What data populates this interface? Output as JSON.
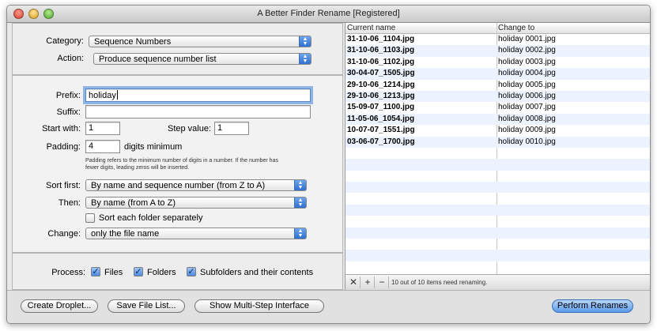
{
  "window": {
    "title": "A Better Finder Rename [Registered]"
  },
  "settings": {
    "category_label": "Category:",
    "category_value": "Sequence Numbers",
    "action_label": "Action:",
    "action_value": "Produce sequence number list",
    "prefix_label": "Prefix:",
    "prefix_value": "holiday",
    "suffix_label": "Suffix:",
    "suffix_value": "",
    "start_label": "Start with:",
    "start_value": "1",
    "step_label": "Step value:",
    "step_value": "1",
    "padding_label": "Padding:",
    "padding_value": "4",
    "padding_suffix": "digits minimum",
    "padding_help_1": "Padding refers to the minimum number of digits in a number. If the number has",
    "padding_help_2": "fewer digits, leading zeros will be inserted.",
    "sort_first_label": "Sort first:",
    "sort_first_value": "By name and sequence number (from Z to A)",
    "then_label": "Then:",
    "then_value": "By name (from A to Z)",
    "sort_folder_label": "Sort each folder separately",
    "sort_folder_checked": false,
    "change_label": "Change:",
    "change_value": "only the file name"
  },
  "process": {
    "label": "Process:",
    "files_label": "Files",
    "files_checked": true,
    "folders_label": "Folders",
    "folders_checked": true,
    "subfolders_label": "Subfolders and their contents",
    "subfolders_checked": true
  },
  "preview": {
    "col_current": "Current name",
    "col_change": "Change to",
    "rows": [
      {
        "current": "31-10-06_1104.jpg",
        "change": "holiday 0001.jpg"
      },
      {
        "current": "31-10-06_1103.jpg",
        "change": "holiday 0002.jpg"
      },
      {
        "current": "31-10-06_1102.jpg",
        "change": "holiday 0003.jpg"
      },
      {
        "current": "30-04-07_1505.jpg",
        "change": "holiday 0004.jpg"
      },
      {
        "current": "29-10-06_1214.jpg",
        "change": "holiday 0005.jpg"
      },
      {
        "current": "29-10-06_1213.jpg",
        "change": "holiday 0006.jpg"
      },
      {
        "current": "15-09-07_1100.jpg",
        "change": "holiday 0007.jpg"
      },
      {
        "current": "11-05-06_1054.jpg",
        "change": "holiday 0008.jpg"
      },
      {
        "current": "10-07-07_1551.jpg",
        "change": "holiday 0009.jpg"
      },
      {
        "current": "03-06-07_1700.jpg",
        "change": "holiday 0010.jpg"
      }
    ],
    "status": "10 out of 10 items need renaming.",
    "remove_symbol": "✕",
    "add_symbol": "+",
    "minus_symbol": "−"
  },
  "buttons": {
    "create_droplet": "Create Droplet...",
    "save_file_list": "Save File List...",
    "multi_step": "Show Multi-Step Interface",
    "perform": "Perform Renames"
  },
  "colors": {
    "accent": "#5b9aea",
    "row_alt": "#edf3fe"
  }
}
